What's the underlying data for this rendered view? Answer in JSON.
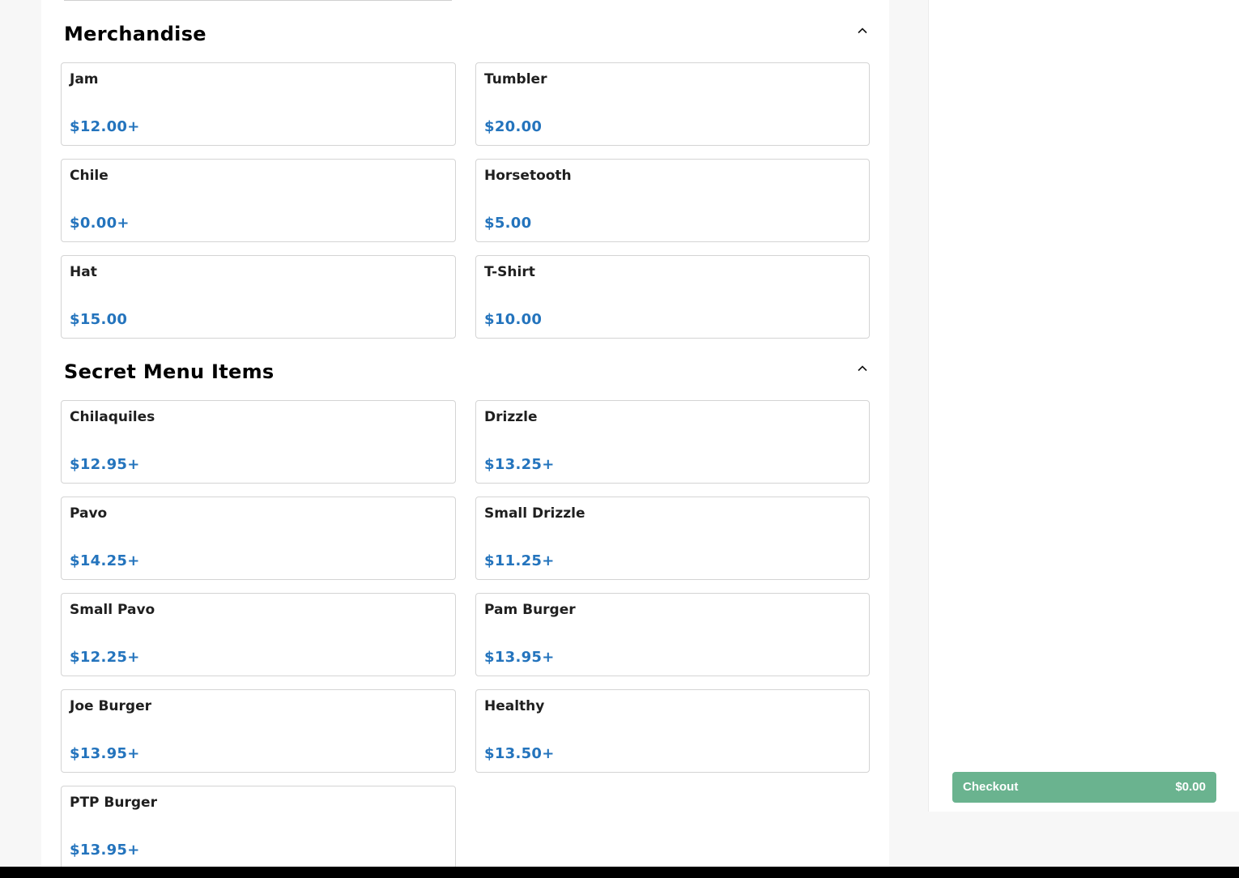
{
  "sections": [
    {
      "title": "Merchandise",
      "items": [
        {
          "name": "Jam",
          "price": "$12.00+"
        },
        {
          "name": "Tumbler",
          "price": "$20.00"
        },
        {
          "name": "Chile",
          "price": "$0.00+"
        },
        {
          "name": "Horsetooth",
          "price": "$5.00"
        },
        {
          "name": "Hat",
          "price": "$15.00"
        },
        {
          "name": "T-Shirt",
          "price": "$10.00"
        }
      ]
    },
    {
      "title": "Secret Menu Items",
      "items": [
        {
          "name": "Chilaquiles",
          "price": "$12.95+"
        },
        {
          "name": "Drizzle",
          "price": "$13.25+"
        },
        {
          "name": "Pavo",
          "price": "$14.25+"
        },
        {
          "name": "Small Drizzle",
          "price": "$11.25+"
        },
        {
          "name": "Small Pavo",
          "price": "$12.25+"
        },
        {
          "name": "Pam Burger",
          "price": "$13.95+"
        },
        {
          "name": "Joe Burger",
          "price": "$13.95+"
        },
        {
          "name": "Healthy",
          "price": "$13.50+"
        },
        {
          "name": "PTP Burger",
          "price": "$13.95+"
        }
      ]
    }
  ],
  "cart": {
    "checkout_label": "Checkout",
    "total": "$0.00"
  },
  "colors": {
    "price": "#2474bd",
    "checkout_button": "#6ab38f"
  },
  "icons": {
    "collapse": "chevron-up-icon"
  }
}
